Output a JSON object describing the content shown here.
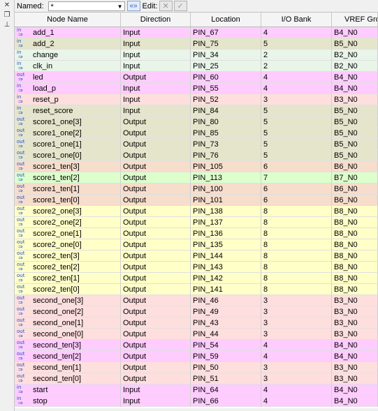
{
  "toolbar": {
    "named_label": "Named:",
    "named_value": "*",
    "edit_label": "Edit:"
  },
  "columns": [
    "Node Name",
    "Direction",
    "Location",
    "I/O Bank",
    "VREF Group"
  ],
  "colors": {
    "magenta": "#ffccff",
    "tan": "#e5e5cc",
    "mint": "#e9f5e9",
    "peach": "#f7ddcc",
    "green": "#ddffcc",
    "yellow": "#ffffc8",
    "pink": "#ffdede"
  },
  "rows": [
    {
      "io": "in",
      "name": "add_1",
      "direction": "Input",
      "location": "PIN_67",
      "bank": "4",
      "vref": "B4_N0",
      "color": "#ffccff"
    },
    {
      "io": "in",
      "name": "add_2",
      "direction": "Input",
      "location": "PIN_75",
      "bank": "5",
      "vref": "B5_N0",
      "color": "#e5e5cc"
    },
    {
      "io": "in",
      "name": "change",
      "direction": "Input",
      "location": "PIN_34",
      "bank": "2",
      "vref": "B2_N0",
      "color": "#e9f5e9"
    },
    {
      "io": "in",
      "name": "clk_in",
      "direction": "Input",
      "location": "PIN_25",
      "bank": "2",
      "vref": "B2_N0",
      "color": "#e9f5e9"
    },
    {
      "io": "out",
      "name": "led",
      "direction": "Output",
      "location": "PIN_60",
      "bank": "4",
      "vref": "B4_N0",
      "color": "#ffccff"
    },
    {
      "io": "in",
      "name": "load_p",
      "direction": "Input",
      "location": "PIN_55",
      "bank": "4",
      "vref": "B4_N0",
      "color": "#ffccff"
    },
    {
      "io": "in",
      "name": "reset_p",
      "direction": "Input",
      "location": "PIN_52",
      "bank": "3",
      "vref": "B3_N0",
      "color": "#ffdede"
    },
    {
      "io": "in",
      "name": "reset_score",
      "direction": "Input",
      "location": "PIN_84",
      "bank": "5",
      "vref": "B5_N0",
      "color": "#e5e5cc"
    },
    {
      "io": "out",
      "name": "score1_one[3]",
      "direction": "Output",
      "location": "PIN_80",
      "bank": "5",
      "vref": "B5_N0",
      "color": "#e5e5cc"
    },
    {
      "io": "out",
      "name": "score1_one[2]",
      "direction": "Output",
      "location": "PIN_85",
      "bank": "5",
      "vref": "B5_N0",
      "color": "#e5e5cc"
    },
    {
      "io": "out",
      "name": "score1_one[1]",
      "direction": "Output",
      "location": "PIN_73",
      "bank": "5",
      "vref": "B5_N0",
      "color": "#e5e5cc"
    },
    {
      "io": "out",
      "name": "score1_one[0]",
      "direction": "Output",
      "location": "PIN_76",
      "bank": "5",
      "vref": "B5_N0",
      "color": "#e5e5cc"
    },
    {
      "io": "out",
      "name": "score1_ten[3]",
      "direction": "Output",
      "location": "PIN_105",
      "bank": "6",
      "vref": "B6_N0",
      "color": "#f7ddcc"
    },
    {
      "io": "out",
      "name": "score1_ten[2]",
      "direction": "Output",
      "location": "PIN_113",
      "bank": "7",
      "vref": "B7_N0",
      "color": "#ddffcc"
    },
    {
      "io": "out",
      "name": "score1_ten[1]",
      "direction": "Output",
      "location": "PIN_100",
      "bank": "6",
      "vref": "B6_N0",
      "color": "#f7ddcc"
    },
    {
      "io": "out",
      "name": "score1_ten[0]",
      "direction": "Output",
      "location": "PIN_101",
      "bank": "6",
      "vref": "B6_N0",
      "color": "#f7ddcc"
    },
    {
      "io": "out",
      "name": "score2_one[3]",
      "direction": "Output",
      "location": "PIN_138",
      "bank": "8",
      "vref": "B8_N0",
      "color": "#ffffc8"
    },
    {
      "io": "out",
      "name": "score2_one[2]",
      "direction": "Output",
      "location": "PIN_137",
      "bank": "8",
      "vref": "B8_N0",
      "color": "#ffffc8"
    },
    {
      "io": "out",
      "name": "score2_one[1]",
      "direction": "Output",
      "location": "PIN_136",
      "bank": "8",
      "vref": "B8_N0",
      "color": "#ffffc8"
    },
    {
      "io": "out",
      "name": "score2_one[0]",
      "direction": "Output",
      "location": "PIN_135",
      "bank": "8",
      "vref": "B8_N0",
      "color": "#ffffc8"
    },
    {
      "io": "out",
      "name": "score2_ten[3]",
      "direction": "Output",
      "location": "PIN_144",
      "bank": "8",
      "vref": "B8_N0",
      "color": "#ffffc8"
    },
    {
      "io": "out",
      "name": "score2_ten[2]",
      "direction": "Output",
      "location": "PIN_143",
      "bank": "8",
      "vref": "B8_N0",
      "color": "#ffffc8"
    },
    {
      "io": "out",
      "name": "score2_ten[1]",
      "direction": "Output",
      "location": "PIN_142",
      "bank": "8",
      "vref": "B8_N0",
      "color": "#ffffc8"
    },
    {
      "io": "out",
      "name": "score2_ten[0]",
      "direction": "Output",
      "location": "PIN_141",
      "bank": "8",
      "vref": "B8_N0",
      "color": "#ffffc8"
    },
    {
      "io": "out",
      "name": "second_one[3]",
      "direction": "Output",
      "location": "PIN_46",
      "bank": "3",
      "vref": "B3_N0",
      "color": "#ffdede"
    },
    {
      "io": "out",
      "name": "second_one[2]",
      "direction": "Output",
      "location": "PIN_49",
      "bank": "3",
      "vref": "B3_N0",
      "color": "#ffdede"
    },
    {
      "io": "out",
      "name": "second_one[1]",
      "direction": "Output",
      "location": "PIN_43",
      "bank": "3",
      "vref": "B3_N0",
      "color": "#ffdede"
    },
    {
      "io": "out",
      "name": "second_one[0]",
      "direction": "Output",
      "location": "PIN_44",
      "bank": "3",
      "vref": "B3_N0",
      "color": "#ffdede"
    },
    {
      "io": "out",
      "name": "second_ten[3]",
      "direction": "Output",
      "location": "PIN_54",
      "bank": "4",
      "vref": "B4_N0",
      "color": "#ffccff"
    },
    {
      "io": "out",
      "name": "second_ten[2]",
      "direction": "Output",
      "location": "PIN_59",
      "bank": "4",
      "vref": "B4_N0",
      "color": "#ffccff"
    },
    {
      "io": "out",
      "name": "second_ten[1]",
      "direction": "Output",
      "location": "PIN_50",
      "bank": "3",
      "vref": "B3_N0",
      "color": "#ffdede"
    },
    {
      "io": "out",
      "name": "second_ten[0]",
      "direction": "Output",
      "location": "PIN_51",
      "bank": "3",
      "vref": "B3_N0",
      "color": "#ffdede"
    },
    {
      "io": "in",
      "name": "start",
      "direction": "Input",
      "location": "PIN_64",
      "bank": "4",
      "vref": "B4_N0",
      "color": "#ffccff"
    },
    {
      "io": "in",
      "name": "stop",
      "direction": "Input",
      "location": "PIN_66",
      "bank": "4",
      "vref": "B4_N0",
      "color": "#ffccff"
    }
  ]
}
